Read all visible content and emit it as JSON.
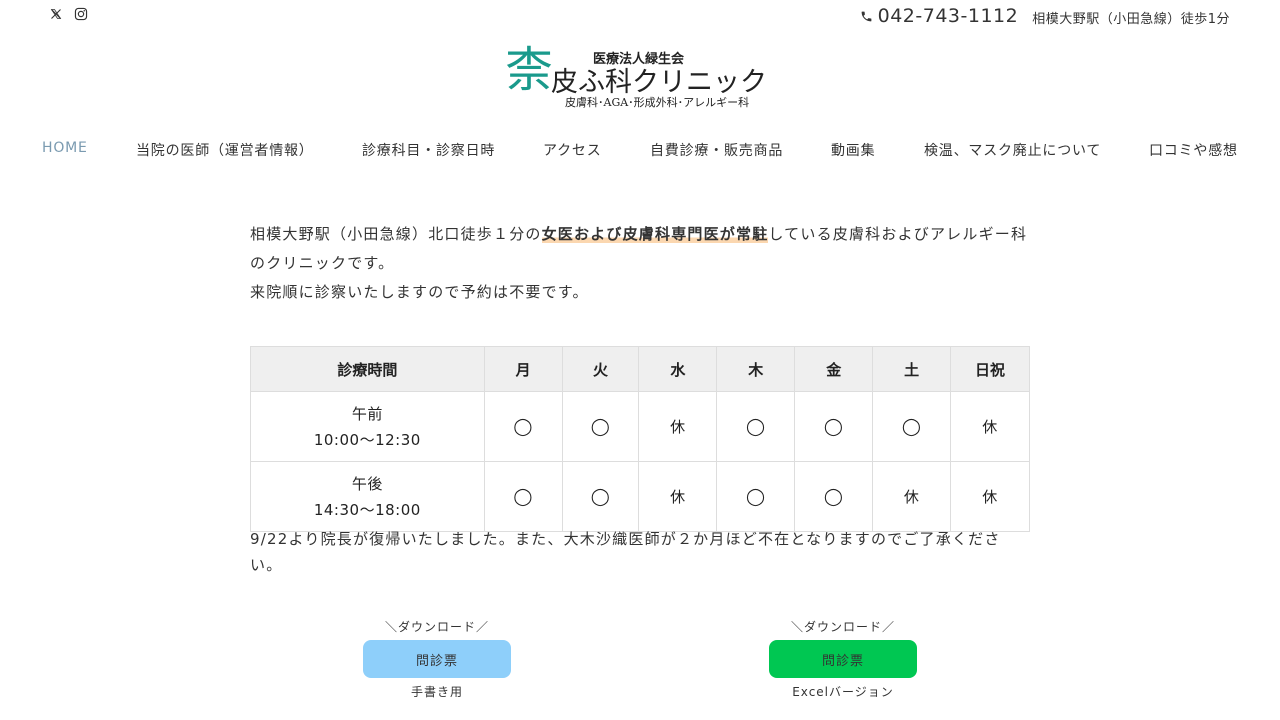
{
  "header": {
    "social": [
      {
        "name": "x-icon"
      },
      {
        "name": "instagram-icon"
      }
    ],
    "phone_icon": "phone-icon",
    "phone": "042-743-1112",
    "station": "相模大野駅（小田急線）徒歩1分"
  },
  "logo": {
    "mark": "柰",
    "corp": "医療法人緑生会",
    "name": "皮ふ科クリニック",
    "sub": "皮膚科･AGA･形成外科･アレルギー科"
  },
  "nav": [
    {
      "label": "HOME",
      "active": true
    },
    {
      "label": "当院の医師（運営者情報）"
    },
    {
      "label": "診療科目・診察日時"
    },
    {
      "label": "アクセス"
    },
    {
      "label": "自費診療・販売商品"
    },
    {
      "label": "動画集"
    },
    {
      "label": "検温、マスク廃止について"
    },
    {
      "label": "口コミや感想"
    }
  ],
  "intro": {
    "part1": "相模大野駅（小田急線）北口徒歩１分の",
    "highlight": "女医および皮膚科専門医が常駐",
    "part2": "している皮膚科およびアレルギー科のクリニックです。",
    "line2": "来院順に診察いたしますので予約は不要です。"
  },
  "schedule": {
    "headers": [
      "診療時間",
      "月",
      "火",
      "水",
      "木",
      "金",
      "土",
      "日祝"
    ],
    "rows": [
      {
        "period": "午前",
        "time": "10:00～12:30",
        "days": [
          "◯",
          "◯",
          "休",
          "◯",
          "◯",
          "◯",
          "休"
        ]
      },
      {
        "period": "午後",
        "time": "14:30～18:00",
        "days": [
          "◯",
          "◯",
          "休",
          "◯",
          "◯",
          "休",
          "休"
        ]
      }
    ]
  },
  "notice": "9/22より院長が復帰いたしました。また、大木沙織医師が２か月ほど不在となりますのでご了承ください。",
  "downloads": [
    {
      "label": "＼ダウンロード／",
      "button": "問診票",
      "sub": "手書き用",
      "color": "#8ecffa"
    },
    {
      "label": "＼ダウンロード／",
      "button": "問診票",
      "sub": "Excelバージョン",
      "color": "#00c752"
    }
  ]
}
